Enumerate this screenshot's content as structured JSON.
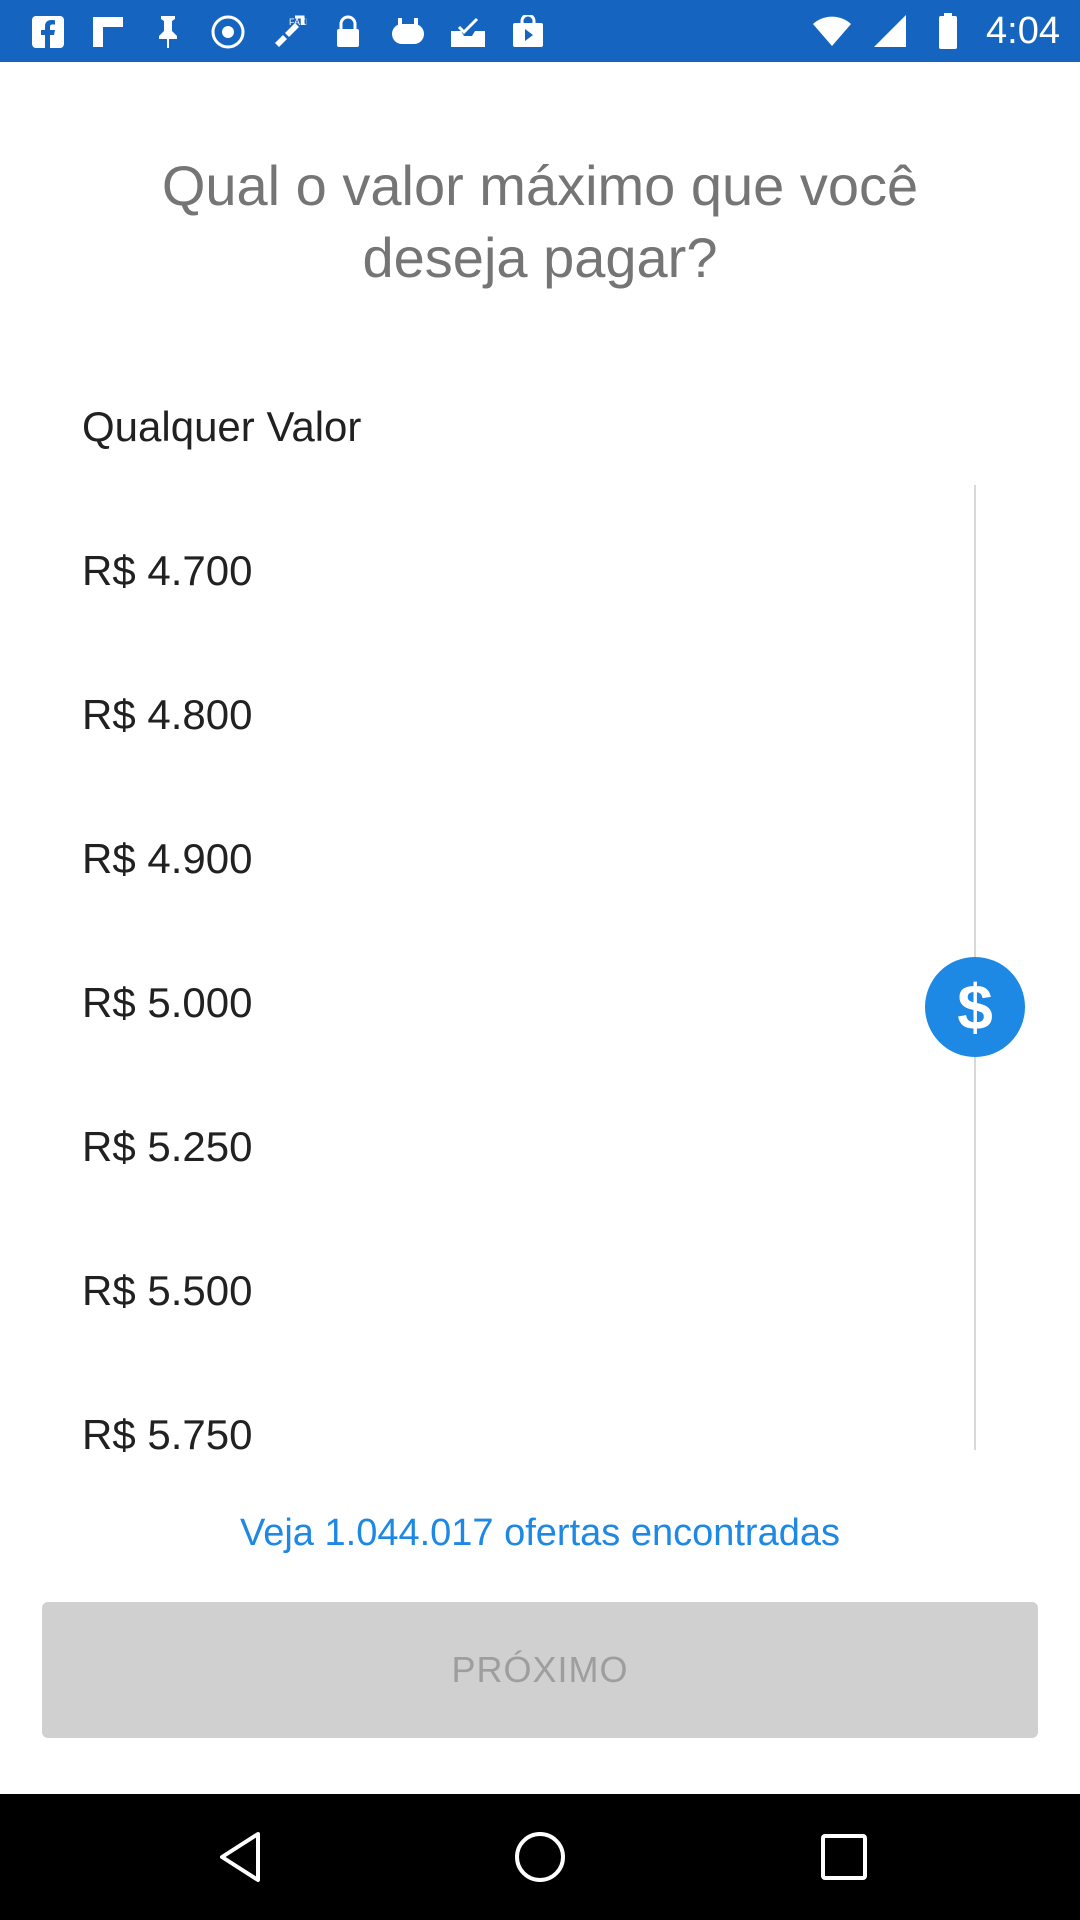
{
  "status_bar": {
    "time": "4:04",
    "left_icons": [
      "facebook-icon",
      "flipboard-icon",
      "pin-icon",
      "music-circle-icon",
      "fake-gps-icon",
      "lock-icon",
      "gamepad-icon",
      "inbox-icon",
      "play-bag-icon"
    ],
    "right_icons": [
      "wifi-icon",
      "signal-icon",
      "battery-icon"
    ]
  },
  "page": {
    "title": "Qual o valor máximo que você deseja pagar?"
  },
  "picker": {
    "items": [
      "Qualquer Valor",
      "R$ 4.700",
      "R$ 4.800",
      "R$ 4.900",
      "R$ 5.000",
      "R$ 5.250",
      "R$ 5.500",
      "R$ 5.750"
    ],
    "thumb_icon": "dollar-icon",
    "thumb_symbol": "$",
    "selected": "R$ 5.000"
  },
  "offers_link": "Veja 1.044.017 ofertas encontradas",
  "next_button": "PRÓXIMO",
  "nav_bar": {
    "icons": [
      "back-icon",
      "home-icon",
      "recents-icon"
    ]
  },
  "colors": {
    "status_bar": "#1565c0",
    "accent": "#1e88e5",
    "title": "#757575",
    "button_bg": "#d0d0d0",
    "button_text": "#9e9e9e"
  }
}
